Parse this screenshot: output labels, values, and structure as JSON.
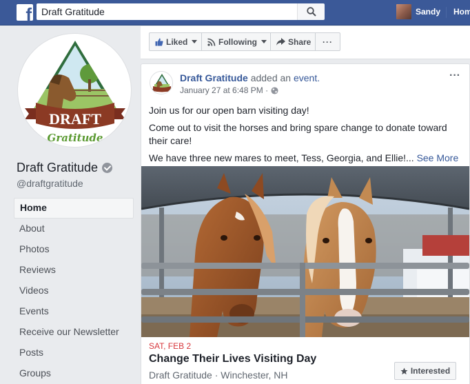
{
  "topbar": {
    "logo_letter": "f",
    "search_value": "Draft Gratitude",
    "user_name": "Sandy",
    "home_label": "Home"
  },
  "page": {
    "logo_text": "DRAFT",
    "logo_subtext": "Gratitude",
    "name": "Draft Gratitude",
    "handle": "@draftgratitude",
    "nav": [
      {
        "label": "Home",
        "active": true
      },
      {
        "label": "About"
      },
      {
        "label": "Photos"
      },
      {
        "label": "Reviews"
      },
      {
        "label": "Videos"
      },
      {
        "label": "Events"
      },
      {
        "label": "Receive our Newsletter"
      },
      {
        "label": "Posts"
      },
      {
        "label": "Groups"
      }
    ]
  },
  "actions": {
    "liked": "Liked",
    "following": "Following",
    "share": "Share",
    "more": "···"
  },
  "post": {
    "author": "Draft Gratitude",
    "action_text": "added an",
    "action_link": "event.",
    "time": "January 27 at 6:48 PM ·",
    "menu": "···",
    "paragraphs": [
      "Join us for our open barn visiting day!",
      "Come out to visit the horses and bring spare change to donate toward their care!",
      "We have three new mares to meet, Tess, Georgia, and Ellie!..."
    ],
    "see_more": "See More",
    "event": {
      "date": "SAT, FEB 2",
      "title": "Change Their Lives Visiting Day",
      "location": "Draft Gratitude · Winchester, NH",
      "interested_label": "Interested"
    }
  },
  "colors": {
    "brand": "#3b5998",
    "link": "#365899",
    "event_date": "#d7363b"
  }
}
